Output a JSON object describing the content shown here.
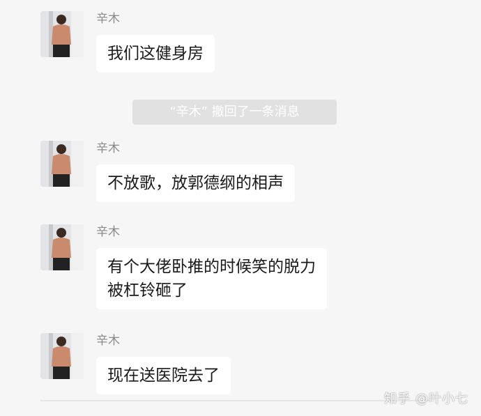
{
  "messages": [
    {
      "sender": "辛木",
      "text": "我们这健身房"
    },
    {
      "sender": "辛木",
      "text": "不放歌，放郭德纲的相声"
    },
    {
      "sender": "辛木",
      "text": "有个大佬卧推的时候笑的脱力\n被杠铃砸了"
    },
    {
      "sender": "辛木",
      "text": "现在送医院去了"
    }
  ],
  "recall_notice": "“辛木” 撤回了一条消息",
  "watermark": "知乎 @叶小七",
  "colors": {
    "background": "#f6f6f6",
    "bubble": "#ffffff",
    "recall_bg": "#e1e1e1"
  },
  "icons": [
    "avatar-photo"
  ]
}
